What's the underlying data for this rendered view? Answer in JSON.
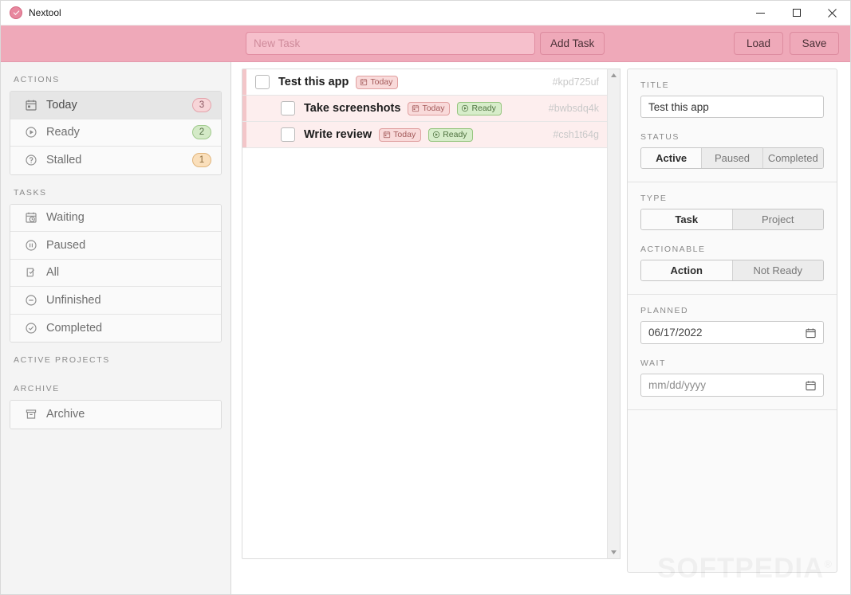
{
  "window": {
    "title": "Nextool",
    "app_icon": "check-circle-icon",
    "minimize_label": "Minimize",
    "maximize_label": "Maximize",
    "close_label": "Close"
  },
  "toolbar": {
    "new_task_value": "",
    "new_task_placeholder": "New Task",
    "add_task_label": "Add Task",
    "load_label": "Load",
    "save_label": "Save",
    "background_color": "#efa9b9"
  },
  "sidebar": {
    "sections": [
      {
        "label": "ACTIONS",
        "items": [
          {
            "label": "Today",
            "icon": "calendar-icon",
            "badge": "3",
            "badge_style": "pink",
            "selected": true
          },
          {
            "label": "Ready",
            "icon": "play-circle-icon",
            "badge": "2",
            "badge_style": "green",
            "selected": false
          },
          {
            "label": "Stalled",
            "icon": "question-circle-icon",
            "badge": "1",
            "badge_style": "orange",
            "selected": false
          }
        ]
      },
      {
        "label": "TASKS",
        "items": [
          {
            "label": "Waiting",
            "icon": "calendar-clock-icon",
            "badge": "",
            "badge_style": "",
            "selected": false
          },
          {
            "label": "Paused",
            "icon": "pause-circle-icon",
            "badge": "",
            "badge_style": "",
            "selected": false
          },
          {
            "label": "All",
            "icon": "checklist-icon",
            "badge": "",
            "badge_style": "",
            "selected": false
          },
          {
            "label": "Unfinished",
            "icon": "minus-circle-icon",
            "badge": "",
            "badge_style": "",
            "selected": false
          },
          {
            "label": "Completed",
            "icon": "check-circle-icon",
            "badge": "",
            "badge_style": "",
            "selected": false
          }
        ]
      },
      {
        "label": "ACTIVE PROJECTS",
        "items": []
      },
      {
        "label": "ARCHIVE",
        "items": [
          {
            "label": "Archive",
            "icon": "archive-box-icon",
            "badge": "",
            "badge_style": "",
            "selected": false
          }
        ]
      }
    ]
  },
  "task_list": {
    "tasks": [
      {
        "title": "Test this app",
        "id": "#kpd725uf",
        "indent": 0,
        "checked": false,
        "selected": true,
        "tags": [
          {
            "label": "Today",
            "style": "today",
            "icon": "calendar-icon"
          }
        ]
      },
      {
        "title": "Take screenshots",
        "id": "#bwbsdq4k",
        "indent": 1,
        "checked": false,
        "selected": false,
        "tags": [
          {
            "label": "Today",
            "style": "today",
            "icon": "calendar-icon"
          },
          {
            "label": "Ready",
            "style": "ready",
            "icon": "play-circle-icon"
          }
        ]
      },
      {
        "title": "Write review",
        "id": "#csh1t64g",
        "indent": 1,
        "checked": false,
        "selected": false,
        "tags": [
          {
            "label": "Today",
            "style": "today",
            "icon": "calendar-icon"
          },
          {
            "label": "Ready",
            "style": "ready",
            "icon": "play-circle-icon"
          }
        ]
      }
    ],
    "scroll_up_label": "Scroll up",
    "scroll_down_label": "Scroll down"
  },
  "detail": {
    "title_label": "TITLE",
    "title_value": "Test this app",
    "status_label": "STATUS",
    "status_options": [
      "Active",
      "Paused",
      "Completed"
    ],
    "status_selected": "Active",
    "type_label": "TYPE",
    "type_options": [
      "Task",
      "Project"
    ],
    "type_selected": "Task",
    "actionable_label": "ACTIONABLE",
    "actionable_options": [
      "Action",
      "Not Ready"
    ],
    "actionable_selected": "Action",
    "planned_label": "PLANNED",
    "planned_value": "06/17/2022",
    "wait_label": "WAIT",
    "wait_value": "",
    "wait_placeholder": "mm/dd/yyyy"
  },
  "watermark": {
    "text": "SOFTPEDIA",
    "mark": "®"
  }
}
